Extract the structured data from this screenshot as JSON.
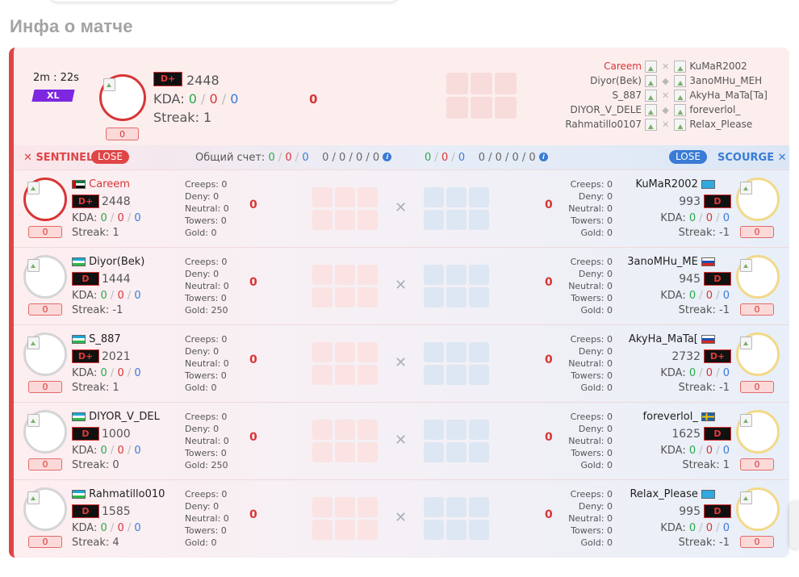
{
  "page": {
    "section_title": "Инфа о матче"
  },
  "summary": {
    "duration": "2m : 22s",
    "mode_badge": "XL",
    "hero_pill": "0",
    "rank": "D+",
    "mmr": "2448",
    "kda_label": "KDA:",
    "kda": {
      "k": "0",
      "d": "0",
      "a": "0"
    },
    "streak": "Streak: 1",
    "center_value": "0",
    "roster": [
      {
        "left": "Careem",
        "left_highlight": true,
        "right": "KuMaR2002"
      },
      {
        "left": "Diyor(Bek)",
        "right": "3anoMHu_MEH"
      },
      {
        "left": "S_887",
        "right": "AkyHa_MaTa[Ta]"
      },
      {
        "left": "DIYOR_V_DELE",
        "right": "foreverlol_"
      },
      {
        "left": "Rahmatillo0107",
        "right": "Relax_Please"
      }
    ]
  },
  "bar": {
    "sentinel_label": "SENTINEL",
    "sentinel_result": "LOSE",
    "score_label": "Общий счет:",
    "left_kda": {
      "k": "0",
      "d": "0",
      "a": "0"
    },
    "left_extra": "0 / 0 / 0 / 0",
    "right_kda": {
      "k": "0",
      "d": "0",
      "a": "0"
    },
    "right_extra": "0 / 0 / 0 / 0",
    "scourge_result": "LOSE",
    "scourge_label": "SCOURGE",
    "colors": {
      "sentinel": "#e04545",
      "scourge": "#3a7bd5",
      "lose_left": "#e04545",
      "lose_right": "#3a7bd5"
    }
  },
  "rows": [
    {
      "left": {
        "name": "Careem",
        "name_red": true,
        "rank": "D+",
        "mmr": "2448",
        "kda": {
          "k": "0",
          "d": "0",
          "a": "0"
        },
        "streak": "Streak: 1",
        "pill": "0",
        "ring": "red",
        "flag": "ae",
        "stats": [
          "Creeps: 0",
          "Deny: 0",
          "Neutral: 0",
          "Towers: 0",
          "Gold: 0"
        ],
        "score": "0"
      },
      "right": {
        "name": "KuMaR2002",
        "rank": "D",
        "mmr": "993",
        "kda": {
          "k": "0",
          "d": "0",
          "a": "0"
        },
        "streak": "Streak: -1",
        "pill": "0",
        "ring": "gold",
        "flag": "kz",
        "stats": [
          "Creeps: 0",
          "Deny: 0",
          "Neutral: 0",
          "Towers: 0",
          "Gold: 0"
        ],
        "score": "0"
      }
    },
    {
      "left": {
        "name": "Diyor(Bek)",
        "rank": "D",
        "mmr": "1444",
        "kda": {
          "k": "0",
          "d": "0",
          "a": "0"
        },
        "streak": "Streak: -1",
        "pill": "0",
        "ring": "grey",
        "flag": "uz",
        "stats": [
          "Creeps: 0",
          "Deny: 0",
          "Neutral: 0",
          "Towers: 0",
          "Gold: 250"
        ],
        "score": "0"
      },
      "right": {
        "name": "3anoMHu_ME",
        "rank": "D",
        "mmr": "945",
        "kda": {
          "k": "0",
          "d": "0",
          "a": "0"
        },
        "streak": "Streak: -1",
        "pill": "0",
        "ring": "gold",
        "flag": "ru",
        "stats": [
          "Creeps: 0",
          "Deny: 0",
          "Neutral: 0",
          "Towers: 0",
          "Gold: 0"
        ],
        "score": "0"
      }
    },
    {
      "left": {
        "name": "S_887",
        "rank": "D+",
        "mmr": "2021",
        "kda": {
          "k": "0",
          "d": "0",
          "a": "0"
        },
        "streak": "Streak: 1",
        "pill": "0",
        "ring": "grey",
        "flag": "uz",
        "stats": [
          "Creeps: 0",
          "Deny: 0",
          "Neutral: 0",
          "Towers: 0",
          "Gold: 0"
        ],
        "score": "0"
      },
      "right": {
        "name": "AkyHa_MaTa[",
        "rank": "D+",
        "mmr": "2732",
        "kda": {
          "k": "0",
          "d": "0",
          "a": "0"
        },
        "streak": "Streak: -1",
        "pill": "0",
        "ring": "gold",
        "flag": "ru",
        "stats": [
          "Creeps: 0",
          "Deny: 0",
          "Neutral: 0",
          "Towers: 0",
          "Gold: 0"
        ],
        "score": "0"
      }
    },
    {
      "left": {
        "name": "DIYOR_V_DEL",
        "rank": "D",
        "mmr": "1000",
        "kda": {
          "k": "0",
          "d": "0",
          "a": "0"
        },
        "streak": "Streak: 0",
        "pill": "0",
        "ring": "grey",
        "flag": "uz",
        "stats": [
          "Creeps: 0",
          "Deny: 0",
          "Neutral: 0",
          "Towers: 0",
          "Gold: 250"
        ],
        "score": "0"
      },
      "right": {
        "name": "foreverlol_",
        "rank": "D",
        "mmr": "1625",
        "kda": {
          "k": "0",
          "d": "0",
          "a": "0"
        },
        "streak": "Streak: 1",
        "pill": "0",
        "ring": "gold",
        "flag": "se",
        "stats": [
          "Creeps: 0",
          "Deny: 0",
          "Neutral: 0",
          "Towers: 0",
          "Gold: 0"
        ],
        "score": "0"
      }
    },
    {
      "left": {
        "name": "Rahmatillo010",
        "rank": "D",
        "mmr": "1585",
        "kda": {
          "k": "0",
          "d": "0",
          "a": "0"
        },
        "streak": "Streak: 4",
        "pill": "0",
        "ring": "grey",
        "flag": "uz",
        "stats": [
          "Creeps: 0",
          "Deny: 0",
          "Neutral: 0",
          "Towers: 0",
          "Gold: 0"
        ],
        "score": "0"
      },
      "right": {
        "name": "Relax_Please",
        "rank": "D",
        "mmr": "995",
        "kda": {
          "k": "0",
          "d": "0",
          "a": "0"
        },
        "streak": "Streak: -1",
        "pill": "0",
        "ring": "gold",
        "flag": "kz",
        "stats": [
          "Creeps: 0",
          "Deny: 0",
          "Neutral: 0",
          "Towers: 0",
          "Gold: 0"
        ],
        "score": "0"
      }
    }
  ],
  "kda_label": "KDA:"
}
